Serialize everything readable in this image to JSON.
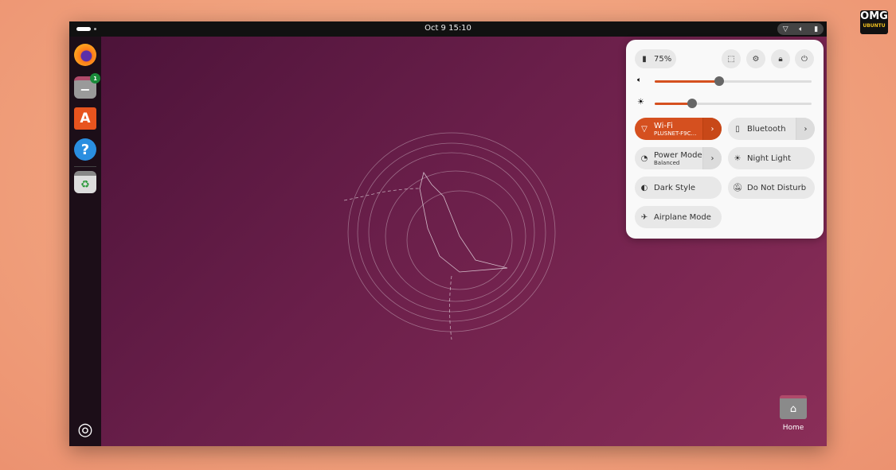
{
  "topbar": {
    "clock": "Oct 9  15:10",
    "tray_icons": [
      "wifi-icon",
      "volume-icon",
      "battery-icon"
    ]
  },
  "dock": {
    "items": [
      "Firefox",
      "Files",
      "App Center",
      "Help",
      "Trash"
    ],
    "files_badge": "1"
  },
  "panel": {
    "battery": "75%",
    "volume_level": 0.41,
    "brightness_level": 0.24,
    "wifi": {
      "label": "Wi-Fi",
      "sub": "PLUSNET-F9C…",
      "active": true
    },
    "bluetooth": {
      "label": "Bluetooth"
    },
    "power_mode": {
      "label": "Power Mode",
      "sub": "Balanced"
    },
    "night_light": {
      "label": "Night Light"
    },
    "dark_style": {
      "label": "Dark Style"
    },
    "dnd": {
      "label": "Do Not Disturb"
    },
    "airplane": {
      "label": "Airplane Mode"
    }
  },
  "desktop": {
    "home_label": "Home"
  },
  "watermark": {
    "text": "OMG",
    "sub": "UBUNTU"
  },
  "colors": {
    "accent": "#d5501f"
  }
}
